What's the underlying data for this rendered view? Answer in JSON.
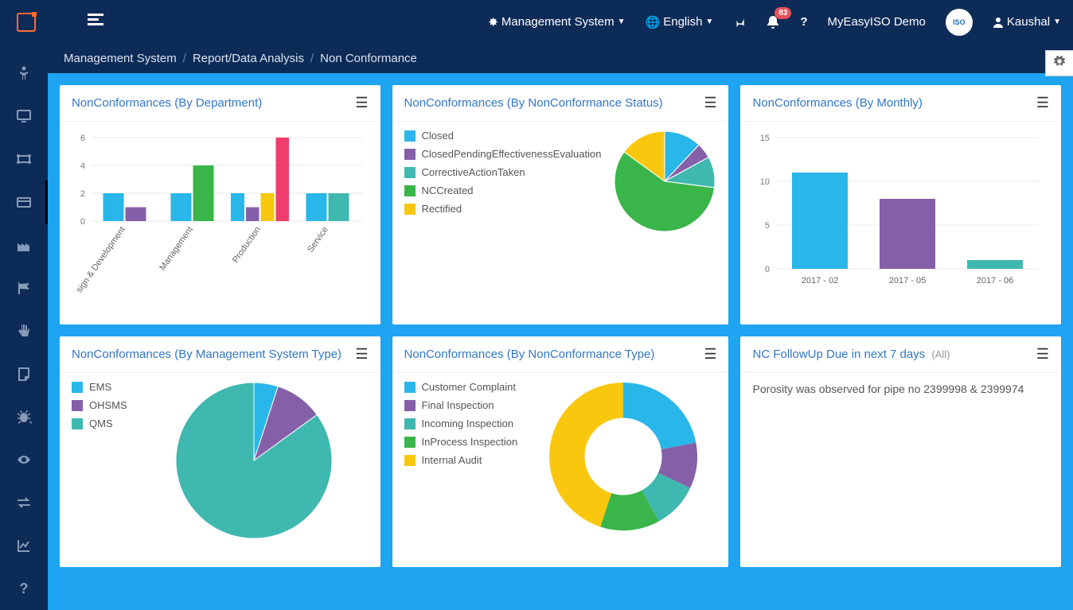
{
  "header": {
    "system_label": "Management System",
    "language_label": "English",
    "notification_count": "83",
    "org_name": "MyEasyISO Demo",
    "user_name": "Kaushal"
  },
  "breadcrumb": {
    "a": "Management System",
    "b": "Report/Data Analysis",
    "c": "Non Conformance"
  },
  "panels": {
    "dept_title": "NonConformances (By Department)",
    "status_title": "NonConformances (By NonConformance Status)",
    "monthly_title": "NonConformances (By Monthly)",
    "mstype_title": "NonConformances (By Management System Type)",
    "nctype_title": "NonConformances (By NonConformance Type)",
    "follow_title": "NC FollowUp Due in next 7 days",
    "follow_sub": "(All)"
  },
  "colors": {
    "blue": "#29b6e8",
    "purple": "#8560a8",
    "teal": "#3fb8af",
    "green": "#39b54a",
    "yellow": "#f9c80e",
    "pink": "#ef3e6d"
  },
  "followup": {
    "item1": "Porosity was observed for pipe no 2399998 & 2399974"
  },
  "chart_data": [
    {
      "id": "dept",
      "type": "bar",
      "title": "NonConformances (By Department)",
      "ylim": [
        0,
        6
      ],
      "yticks": [
        0,
        2,
        4,
        6
      ],
      "categories": [
        "sign & Development",
        "Management",
        "Production",
        "Service"
      ],
      "series": [
        {
          "color_key": "blue",
          "values": [
            2,
            2,
            2,
            2
          ]
        },
        {
          "color_key": "purple",
          "values": [
            1,
            null,
            1,
            null
          ]
        },
        {
          "color_key": "green",
          "values": [
            null,
            4,
            null,
            null
          ]
        },
        {
          "color_key": "yellow",
          "values": [
            null,
            null,
            2,
            null
          ]
        },
        {
          "color_key": "pink",
          "values": [
            null,
            null,
            6,
            null
          ]
        },
        {
          "color_key": "teal",
          "values": [
            null,
            null,
            null,
            2
          ]
        }
      ]
    },
    {
      "id": "status",
      "type": "pie",
      "title": "NonConformances (By NonConformance Status)",
      "legend": [
        {
          "label": "Closed",
          "color_key": "blue"
        },
        {
          "label": "ClosedPendingEffectivenessEvaluation",
          "color_key": "purple"
        },
        {
          "label": "CorrectiveActionTaken",
          "color_key": "teal"
        },
        {
          "label": "NCCreated",
          "color_key": "green"
        },
        {
          "label": "Rectified",
          "color_key": "yellow"
        }
      ],
      "slices": [
        {
          "color_key": "blue",
          "value": 12
        },
        {
          "color_key": "purple",
          "value": 5
        },
        {
          "color_key": "teal",
          "value": 10
        },
        {
          "color_key": "green",
          "value": 58
        },
        {
          "color_key": "yellow",
          "value": 15
        }
      ]
    },
    {
      "id": "monthly",
      "type": "bar",
      "title": "NonConformances (By Monthly)",
      "ylim": [
        0,
        15
      ],
      "yticks": [
        0,
        5,
        10,
        15
      ],
      "categories": [
        "2017 - 02",
        "2017 - 05",
        "2017 - 06"
      ],
      "series": [
        {
          "values": [
            11,
            null,
            null
          ],
          "color_key": "blue"
        },
        {
          "values": [
            null,
            8,
            null
          ],
          "color_key": "purple"
        },
        {
          "values": [
            null,
            null,
            1
          ],
          "color_key": "teal"
        }
      ]
    },
    {
      "id": "mstype",
      "type": "pie",
      "title": "NonConformances (By Management System Type)",
      "legend": [
        {
          "label": "EMS",
          "color_key": "blue"
        },
        {
          "label": "OHSMS",
          "color_key": "purple"
        },
        {
          "label": "QMS",
          "color_key": "teal"
        }
      ],
      "slices": [
        {
          "color_key": "blue",
          "value": 5
        },
        {
          "color_key": "purple",
          "value": 10
        },
        {
          "color_key": "teal",
          "value": 85
        }
      ]
    },
    {
      "id": "nctype",
      "type": "donut",
      "title": "NonConformances (By NonConformance Type)",
      "legend": [
        {
          "label": "Customer Complaint",
          "color_key": "blue"
        },
        {
          "label": "Final Inspection",
          "color_key": "purple"
        },
        {
          "label": "Incoming Inspection",
          "color_key": "teal"
        },
        {
          "label": "InProcess Inspection",
          "color_key": "green"
        },
        {
          "label": "Internal Audit",
          "color_key": "yellow"
        }
      ],
      "slices": [
        {
          "color_key": "blue",
          "value": 22
        },
        {
          "color_key": "purple",
          "value": 10
        },
        {
          "color_key": "teal",
          "value": 10
        },
        {
          "color_key": "green",
          "value": 13
        },
        {
          "color_key": "yellow",
          "value": 45
        }
      ]
    }
  ]
}
